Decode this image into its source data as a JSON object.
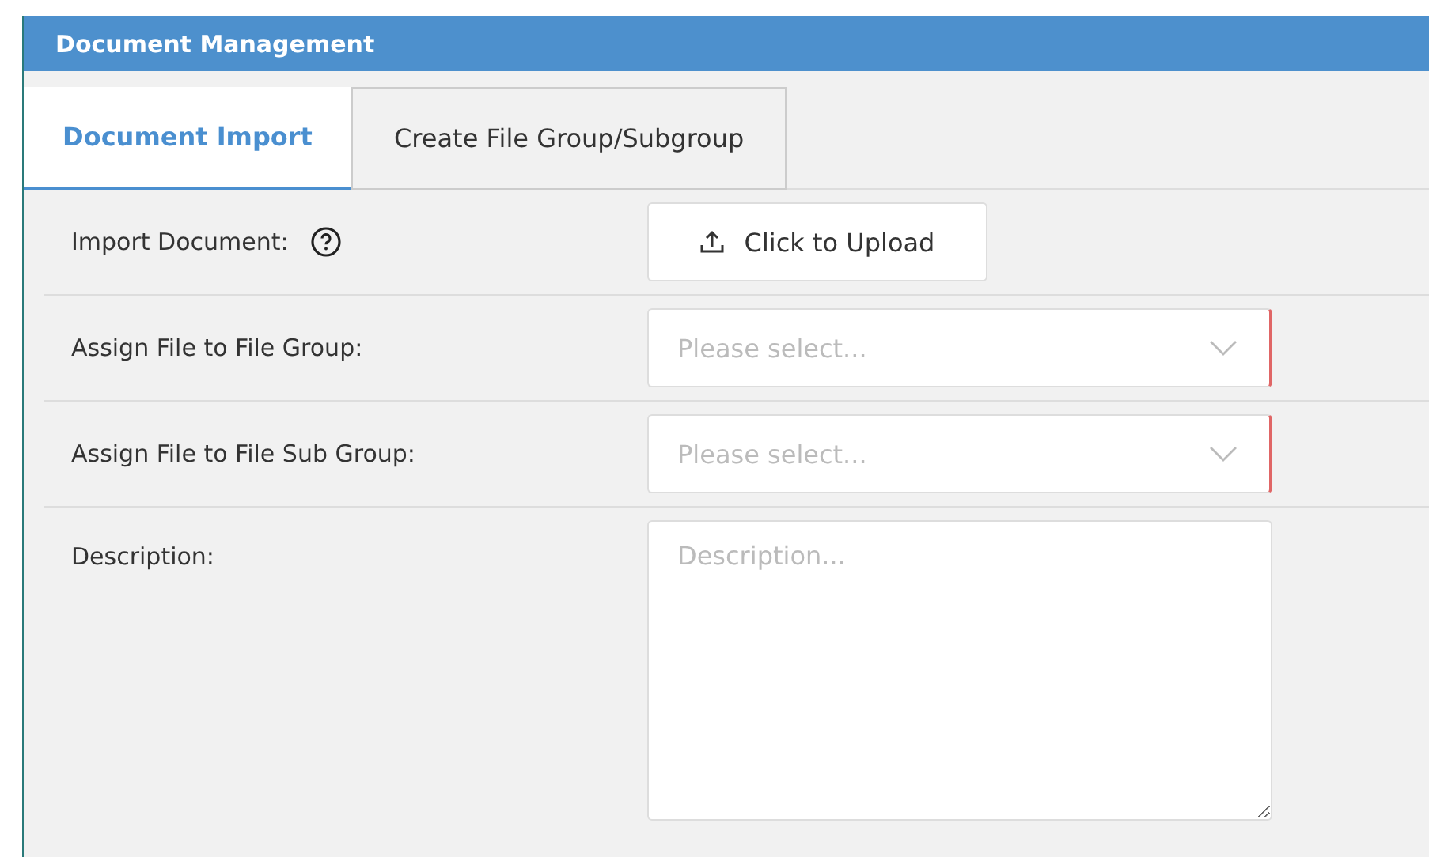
{
  "window": {
    "title": "Document Management"
  },
  "tabs": [
    {
      "label": "Document Import",
      "selected": true
    },
    {
      "label": "Create File Group/Subgroup",
      "selected": false
    }
  ],
  "form": [
    {
      "kind": "upload",
      "label": "Import Document:",
      "help": true,
      "button": "Click to Upload"
    },
    {
      "kind": "select",
      "label": "Assign File to File Group:",
      "placeholder": "Please select...",
      "required": true
    },
    {
      "kind": "select",
      "label": "Assign File to File Sub Group:",
      "placeholder": "Please select...",
      "required": true
    },
    {
      "kind": "textarea",
      "label": "Description:",
      "placeholder": "Description..."
    }
  ]
}
